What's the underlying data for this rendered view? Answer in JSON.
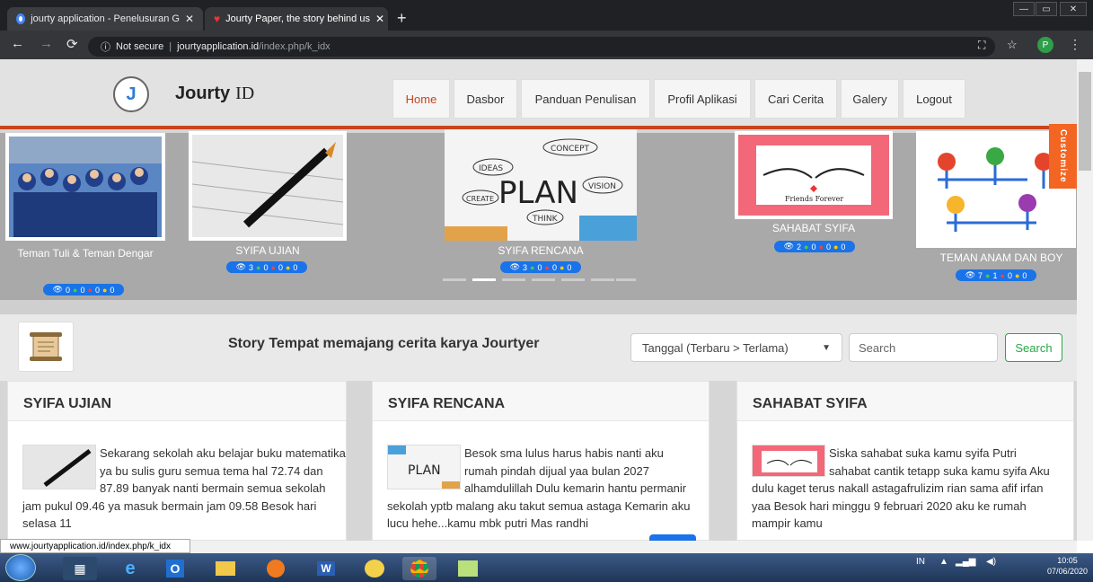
{
  "browser": {
    "tabs": [
      {
        "title": "jourty application - Penelusuran G",
        "close": "✕"
      },
      {
        "title": "Jourty Paper, the story behind us",
        "close": "✕"
      }
    ],
    "new_tab": "+",
    "security": "Not secure",
    "url_host": "jourtyapplication.id",
    "url_path": "/index.php/k_idx",
    "profile_initial": "P",
    "window_buttons": [
      "—",
      "▭",
      "✕"
    ]
  },
  "site": {
    "brand_bold": "Jourty",
    "brand_suffix": "ID",
    "logo_glyph": "J",
    "menu": [
      "Home",
      "Dasbor",
      "Panduan Penulisan",
      "Profil Aplikasi",
      "Cari Cerita",
      "Galery",
      "Logout"
    ],
    "customize": "Customize"
  },
  "slider": [
    {
      "caption": "Teman Tuli & Teman Dengar",
      "views": "0",
      "likes": "0",
      "dislikes": "0",
      "comments": "0"
    },
    {
      "caption": "SYIFA UJIAN",
      "views": "3",
      "likes": "0",
      "dislikes": "0",
      "comments": "0"
    },
    {
      "caption": "SYIFA RENCANA",
      "views": "3",
      "likes": "0",
      "dislikes": "0",
      "comments": "0"
    },
    {
      "caption": "SAHABAT SYIFA",
      "views": "2",
      "likes": "0",
      "dislikes": "0",
      "comments": "0"
    },
    {
      "caption": "TEMAN ANAM DAN BOY",
      "views": "7",
      "likes": "1",
      "dislikes": "0",
      "comments": "0"
    }
  ],
  "plan_words": {
    "big": "PLAN",
    "idea": "IDEAS",
    "concept": "CONCEPT",
    "vision": "VISION",
    "think": "THINK",
    "create": "CREATE"
  },
  "friends_text": "Friends Forever",
  "toolbar": {
    "title": "Story Tempat memajang cerita karya Jourtyer",
    "sort_value": "Tanggal (Terbaru > Terlama)",
    "search_placeholder": "Search",
    "search_button": "Search"
  },
  "cards": [
    {
      "title": "SYIFA UJIAN",
      "text": "Sekarang sekolah aku belajar buku matematika ya bu sulis guru semua tema hal 72.74 dan 87.89 banyak nanti bermain semua sekolah jam pukul 09.46 ya masuk bermain jam 09.58 Besok hari selasa 11"
    },
    {
      "title": "SYIFA RENCANA",
      "text": "Besok sma lulus harus habis nanti aku rumah pindah dijual yaa bulan 2027 alhamdulillah  Dulu kemarin hantu permanir sekolah yptb malang aku takut semua astaga Kemarin aku lucu hehe...kamu mbk putri Mas randhi"
    },
    {
      "title": "SAHABAT SYIFA",
      "text": "Siska sahabat suka kamu syifa Putri sahabat cantik tetapp suka kamu syifa Aku dulu kaget terus nakall astagafrulizim rian sama afif irfan yaa Besok hari minggu 9 februari 2020 aku ke rumah mampir kamu"
    }
  ],
  "status_url": "www.jourtyapplication.id/index.php/k_idx",
  "taskbar": {
    "lang": "IN",
    "time": "10:05",
    "date": "07/06/2020"
  }
}
